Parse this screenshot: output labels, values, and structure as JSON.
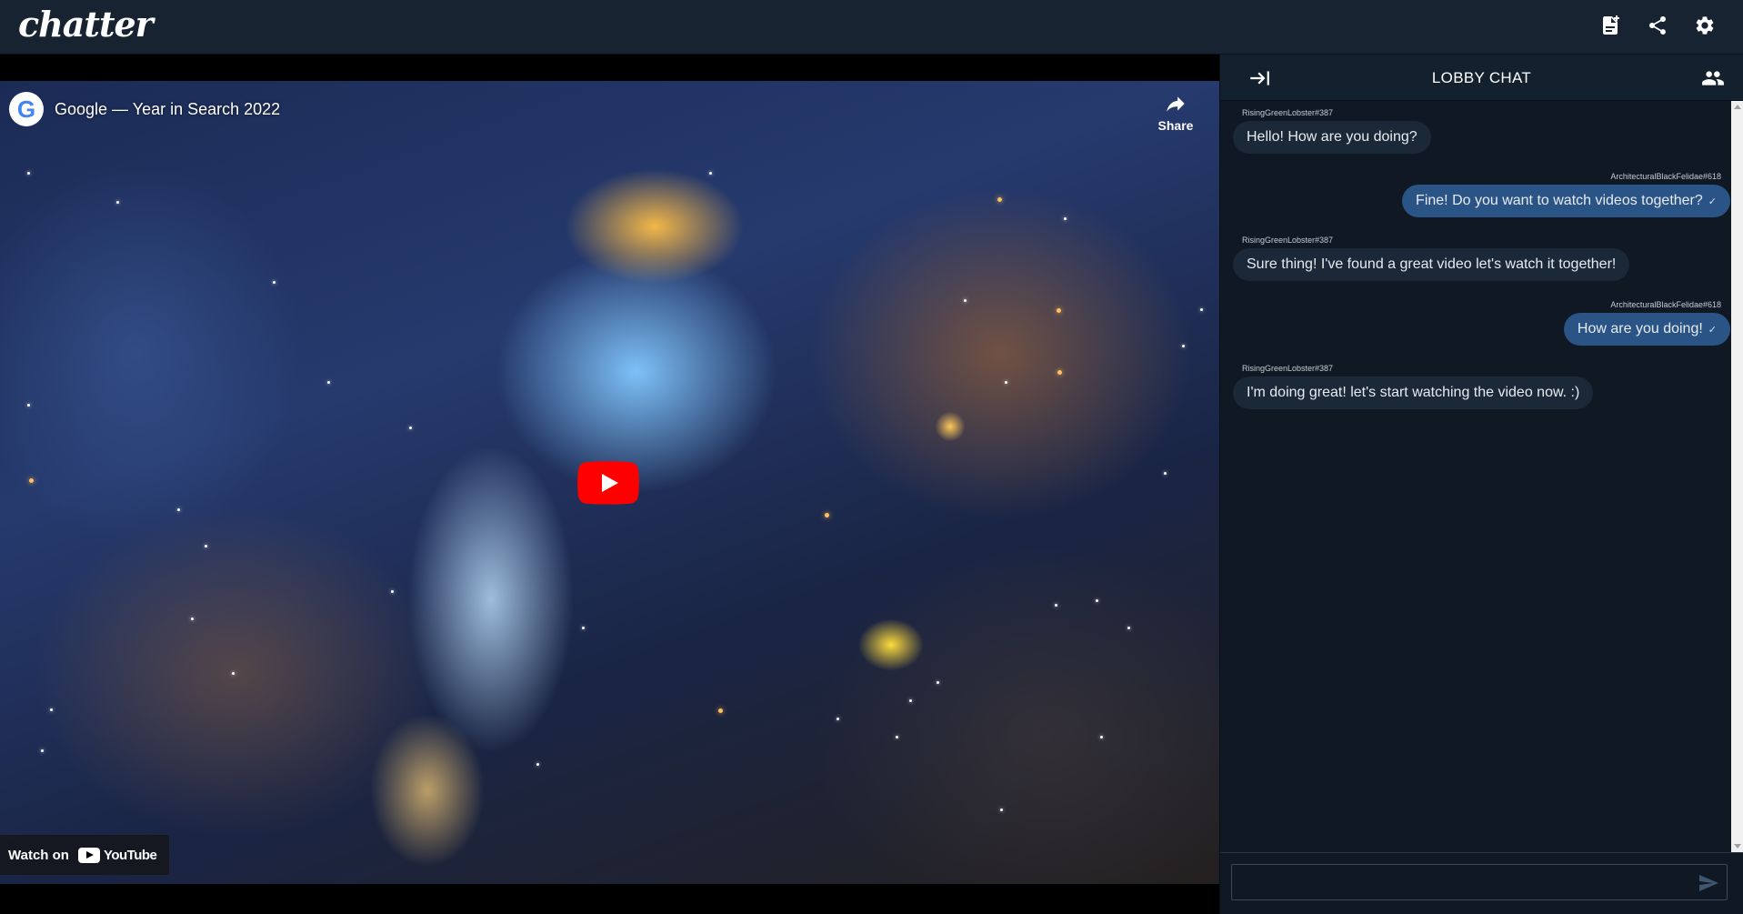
{
  "app": {
    "logo_text": "chatter"
  },
  "topbar": {
    "icons": [
      "note-add-icon",
      "share-icon",
      "gear-icon"
    ]
  },
  "video": {
    "channel_logo_letter": "G",
    "title": "Google — Year in Search 2022",
    "share_label": "Share",
    "watch_on_label": "Watch on",
    "youtube_wordmark": "YouTube"
  },
  "chat": {
    "title": "LOBBY CHAT",
    "messages": [
      {
        "author": "RisingGreenLobster#387",
        "text": "Hello! How are you doing?",
        "direction": "incoming"
      },
      {
        "author": "ArchitecturalBlackFelidae#618",
        "text": "Fine! Do you want to watch videos together?",
        "direction": "outgoing",
        "status": "✓"
      },
      {
        "author": "RisingGreenLobster#387",
        "text": "Sure thing! I've found a great video let's watch it together!",
        "direction": "incoming"
      },
      {
        "author": "ArchitecturalBlackFelidae#618",
        "text": "How are you doing!",
        "direction": "outgoing",
        "status": "✓"
      },
      {
        "author": "RisingGreenLobster#387",
        "text": "I'm doing great! let's start watching the video now. :)",
        "direction": "incoming"
      }
    ],
    "input": {
      "value": "",
      "placeholder": ""
    }
  },
  "colors": {
    "topbar_bg": "#172330",
    "chat_bg": "#0f1823",
    "incoming_bubble": "#1b2837",
    "outgoing_bubble": "#2a5485",
    "youtube_red": "#ff0000"
  }
}
